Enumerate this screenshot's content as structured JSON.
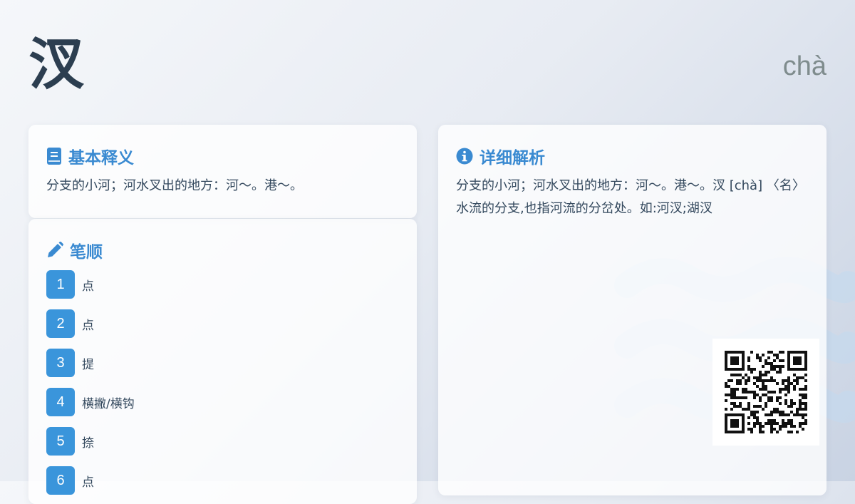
{
  "header": {
    "character": "汊",
    "pinyin": "chà"
  },
  "basic": {
    "title": "基本释义",
    "icon": "book-icon",
    "text": "分支的小河；河水叉出的地方：河～。港～。"
  },
  "strokes": {
    "title": "笔顺",
    "icon": "pencil-icon",
    "items": [
      {
        "num": "1",
        "name": "点"
      },
      {
        "num": "2",
        "name": "点"
      },
      {
        "num": "3",
        "name": "提"
      },
      {
        "num": "4",
        "name": "横撇/横钩"
      },
      {
        "num": "5",
        "name": "捺"
      },
      {
        "num": "6",
        "name": "点"
      }
    ]
  },
  "detail": {
    "title": "详细解析",
    "icon": "info-icon",
    "text": "分支的小河；河水叉出的地方：河～。港～。汊 [chà] 〈名〉 水流的分支,也指河流的分岔处。如:河汊;湖汊"
  },
  "colors": {
    "accent": "#3a8ad1",
    "badge": "#3a95db",
    "text": "#34495e",
    "heading": "#2c3e50",
    "muted": "#7f8c8d"
  }
}
